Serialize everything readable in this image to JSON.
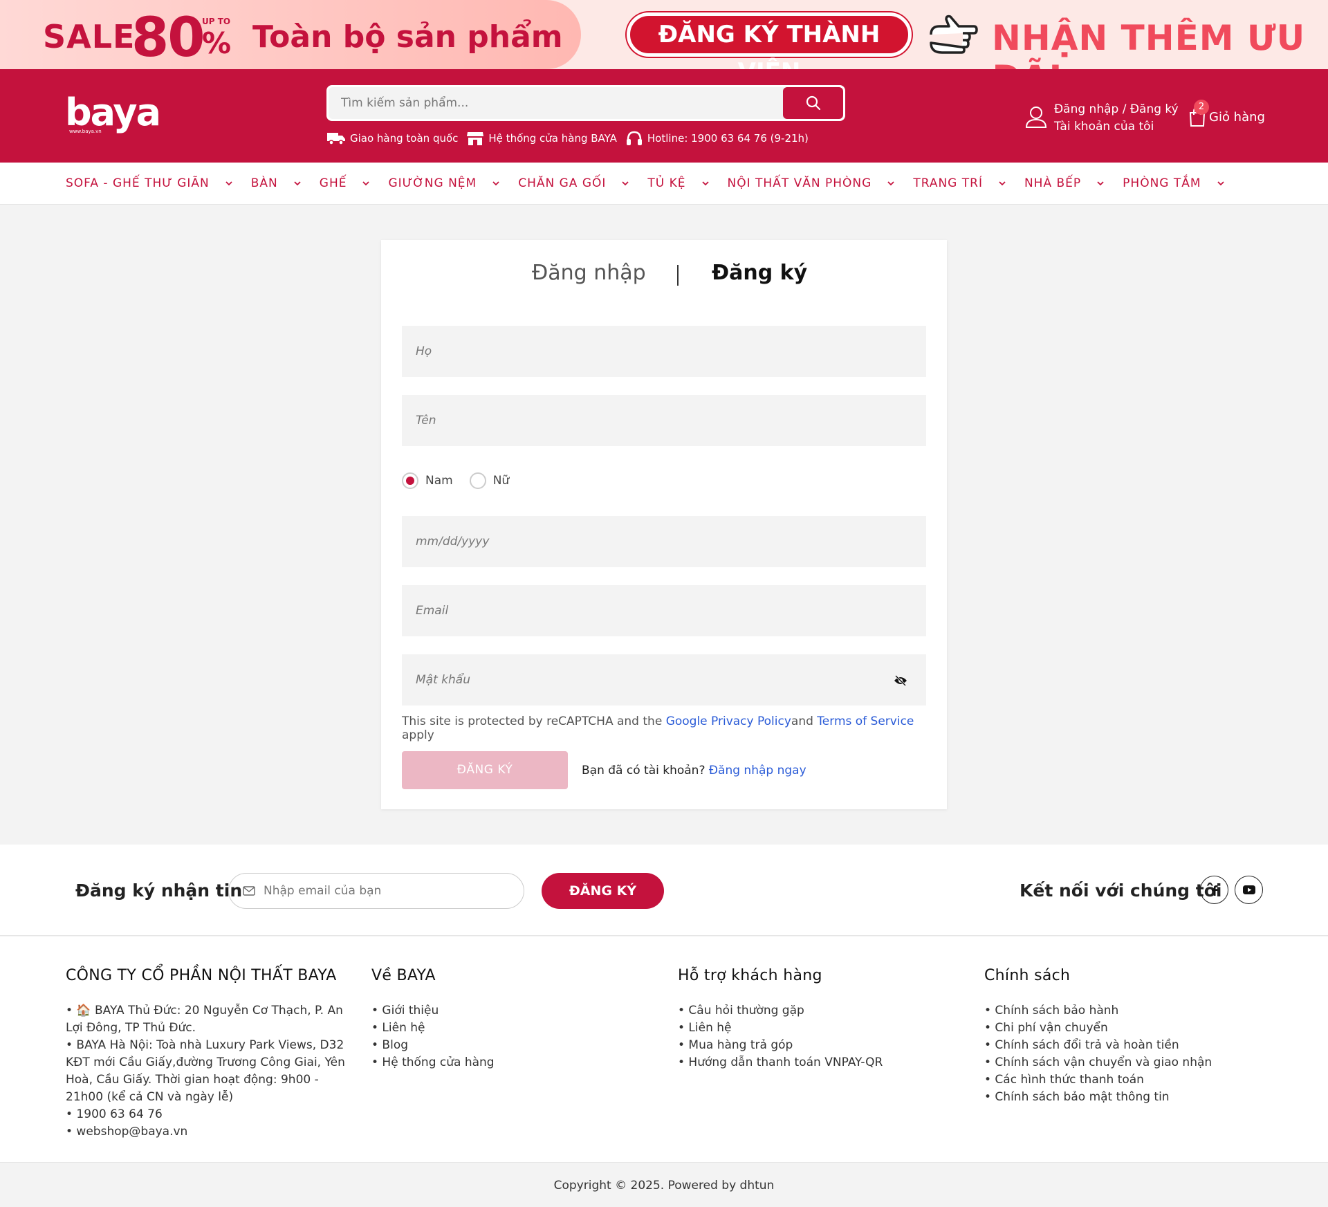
{
  "promo": {
    "sale": "SALE",
    "percent": "80",
    "upto": "UP TO",
    "pct_sign": "%",
    "all_products": "Toàn bộ sản phẩm",
    "member_button": "ĐĂNG KÝ THÀNH VIÊN",
    "more_deals": "NHẬN THÊM ƯU ĐÃI"
  },
  "header": {
    "logo": "baya",
    "logo_sub": "www.baya.vn",
    "search_placeholder": "Tìm kiếm sản phẩm...",
    "features": [
      "Giao hàng toàn quốc",
      "Hệ thống cửa hàng BAYA",
      "Hotline: 1900 63 64 76 (9-21h)"
    ],
    "account_line1": "Đăng nhập / Đăng ký",
    "account_line2": "Tài khoản của tôi",
    "cart_count": "2",
    "cart_label": "Giỏ hàng"
  },
  "nav": [
    "SOFA - GHẾ THƯ GIÃN",
    "BÀN",
    "GHẾ",
    "GIƯỜNG NỆM",
    "CHĂN GA GỐI",
    "TỦ KỆ",
    "NỘI THẤT VĂN PHÒNG",
    "TRANG TRÍ",
    "NHÀ BẾP",
    "PHÒNG TẮM"
  ],
  "form": {
    "tab_login": "Đăng nhập",
    "tab_register": "Đăng ký",
    "last_name_placeholder": "Họ",
    "first_name_placeholder": "Tên",
    "gender_male": "Nam",
    "gender_female": "Nữ",
    "gender_selected": "Nam",
    "birthday_placeholder": "mm/dd/yyyy",
    "email_placeholder": "Email",
    "password_placeholder": "Mật khẩu",
    "recaptcha_prefix": "This site is protected by reCAPTCHA and the ",
    "privacy_link": "Google Privacy Policy",
    "recaptcha_and": "and ",
    "terms_link": "Terms of Service",
    "recaptcha_suffix": " apply",
    "submit": "ĐĂNG KÝ",
    "have_account": "Bạn đã có tài khoản? ",
    "login_now": "Đăng nhập ngay"
  },
  "newsletter": {
    "title": "Đăng ký nhận tin",
    "placeholder": "Nhập email của bạn",
    "button": "ĐĂNG KÝ",
    "connect": "Kết nối với chúng tôi"
  },
  "footer": {
    "company": {
      "title": "CÔNG TY CỔ PHẦN NỘI THẤT BAYA",
      "items": [
        "• 🏠 BAYA Thủ Đức: 20 Nguyễn Cơ Thạch, P. An Lợi Đông, TP Thủ Đức.",
        "• BAYA Hà Nội: Toà nhà Luxury Park Views, D32 KĐT mới Cầu Giấy,đường Trương Công Giai, Yên Hoà, Cầu Giấy. Thời gian hoạt động: 9h00 - 21h00 (kể cả CN và ngày lễ)",
        "• 1900 63 64 76",
        "• webshop@baya.vn"
      ]
    },
    "about": {
      "title": "Về BAYA",
      "items": [
        "• Giới thiệu",
        "• Liên hệ",
        "• Blog",
        "• Hệ thống cửa hàng"
      ]
    },
    "support": {
      "title": "Hỗ trợ khách hàng",
      "items": [
        "• Câu hỏi thường gặp",
        "• Liên hệ",
        "• Mua hàng trả góp",
        "• Hướng dẫn thanh toán VNPAY-QR"
      ]
    },
    "policy": {
      "title": "Chính sách",
      "items": [
        "• Chính sách bảo hành",
        "• Chi phí vận chuyển",
        "• Chính sách đổi trả và hoàn tiền",
        "• Chính sách vận chuyển và giao nhận",
        "• Các hình thức thanh toán",
        "• Chính sách bảo mật thông tin"
      ]
    },
    "copyright": "Copyright © 2025. Powered by dhtun"
  },
  "colors": {
    "brand": "#c4123d",
    "link": "#2a5bd7",
    "disabled_button": "#ecb7c4"
  }
}
